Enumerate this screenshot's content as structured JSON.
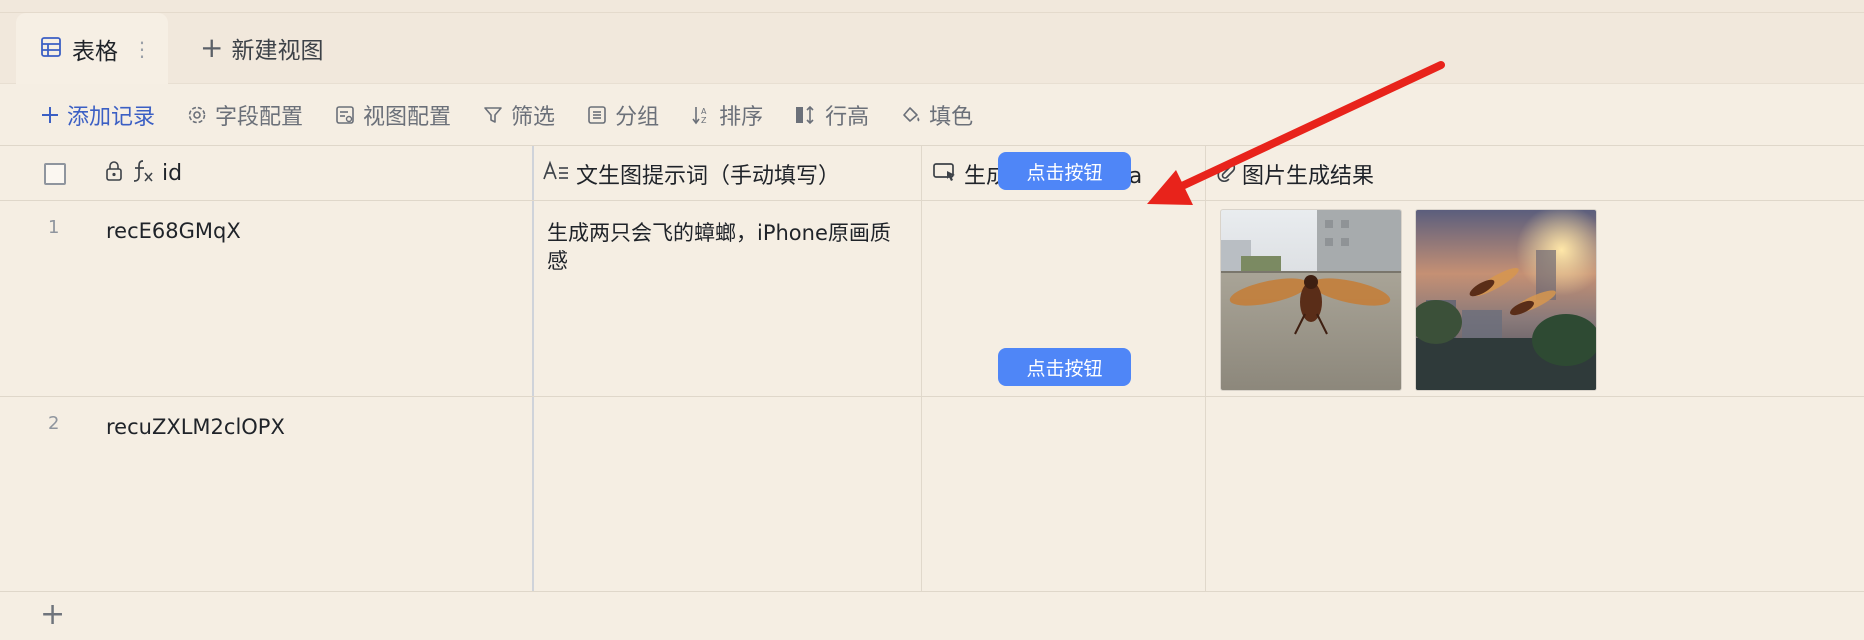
{
  "tabs": {
    "active_label": "表格",
    "new_view_label": "新建视图"
  },
  "toolbar": {
    "add_record": "添加记录",
    "field_config": "字段配置",
    "view_config": "视图配置",
    "filter": "筛选",
    "group": "分组",
    "sort": "排序",
    "row_height": "行高",
    "fill_color": "填色"
  },
  "table": {
    "columns": [
      "id",
      "文生图提示词（手动填写）",
      "生成图片-banana",
      "图片生成结果"
    ],
    "rows": [
      {
        "num": "1",
        "id": "recE68GMqX",
        "prompt": "生成两只会飞的蟑螂，iPhone原画质感",
        "button": "点击按钮",
        "images": [
          "cockroach-flying-wall",
          "cockroaches-flying-sunset"
        ]
      },
      {
        "num": "2",
        "id": "recuZXLM2clOPX",
        "prompt": "",
        "button": "点击按钮",
        "images": []
      }
    ]
  },
  "colors": {
    "background": "#f5eee3",
    "accent": "#3b5fc4",
    "button": "#4f86f7",
    "annotation_arrow": "#e8231b"
  }
}
